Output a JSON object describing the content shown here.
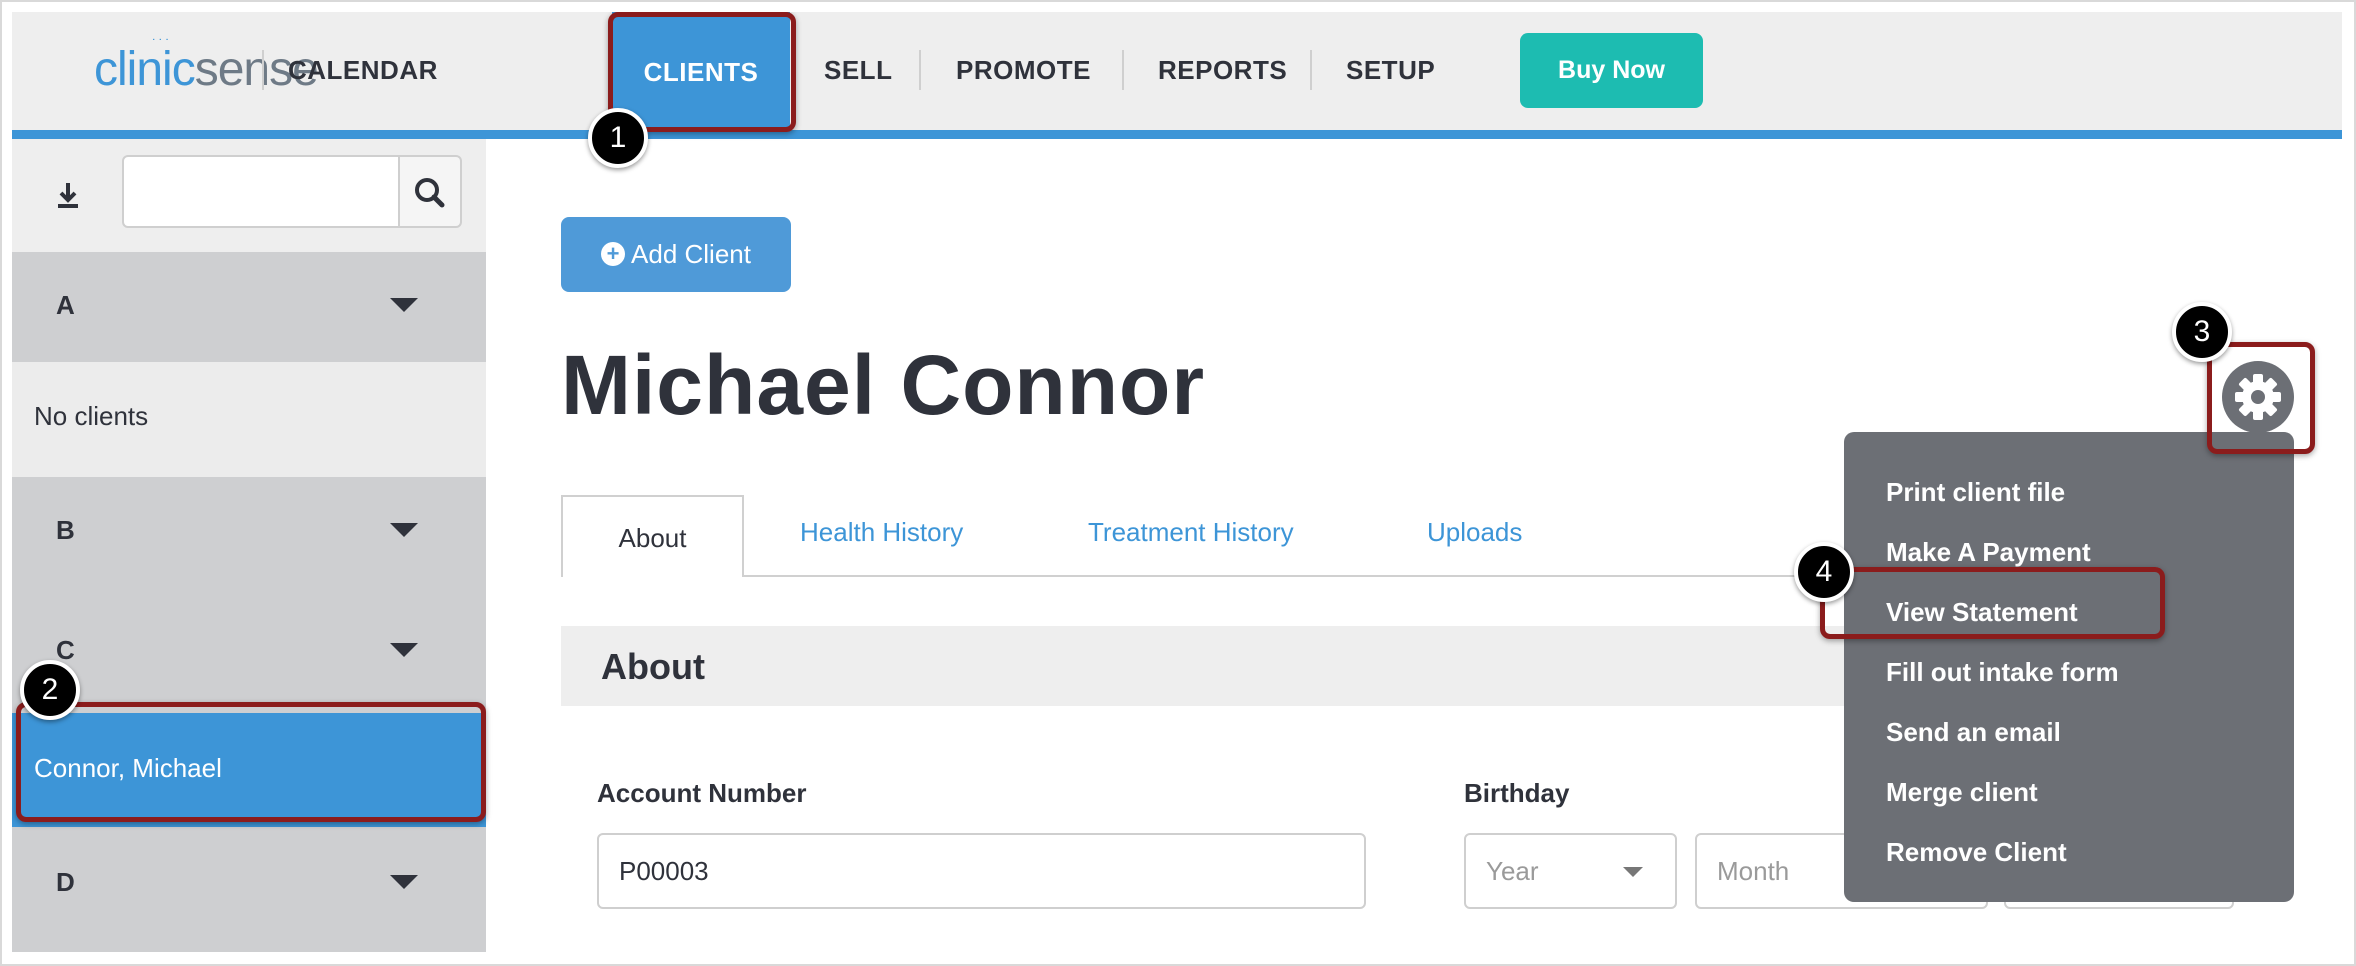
{
  "brand": {
    "logo_part1": "clinic",
    "logo_part2": "sense"
  },
  "nav": {
    "items": [
      "CALENDAR",
      "CLIENTS",
      "SELL",
      "PROMOTE",
      "REPORTS",
      "SETUP"
    ],
    "active": "CLIENTS",
    "buy_label": "Buy Now"
  },
  "sidebar": {
    "search": {
      "value": "",
      "placeholder": ""
    },
    "groups": [
      {
        "letter": "A",
        "items": [],
        "empty_text": "No clients"
      },
      {
        "letter": "B",
        "items": []
      },
      {
        "letter": "C",
        "items": [
          "Connor, Michael"
        ]
      },
      {
        "letter": "D",
        "items": []
      }
    ]
  },
  "main": {
    "add_client_label": "Add Client",
    "client_name": "Michael Connor",
    "tabs": [
      "About",
      "Health History",
      "Treatment History",
      "Uploads"
    ],
    "section_title": "About",
    "fields": {
      "account_number_label": "Account Number",
      "account_number_value": "P00003",
      "birthday_label": "Birthday",
      "year_placeholder": "Year",
      "month_placeholder": "Month"
    }
  },
  "actions_menu": {
    "items": [
      "Print client file",
      "Make A Payment",
      "View Statement",
      "Fill out intake form",
      "Send an email",
      "Merge client",
      "Remove Client"
    ]
  },
  "annotations": [
    "1",
    "2",
    "3",
    "4"
  ],
  "colors": {
    "accent": "#3d95d7",
    "buy": "#1dbcb1",
    "highlight": "#8b1c1c",
    "menu": "#6c6f75"
  }
}
